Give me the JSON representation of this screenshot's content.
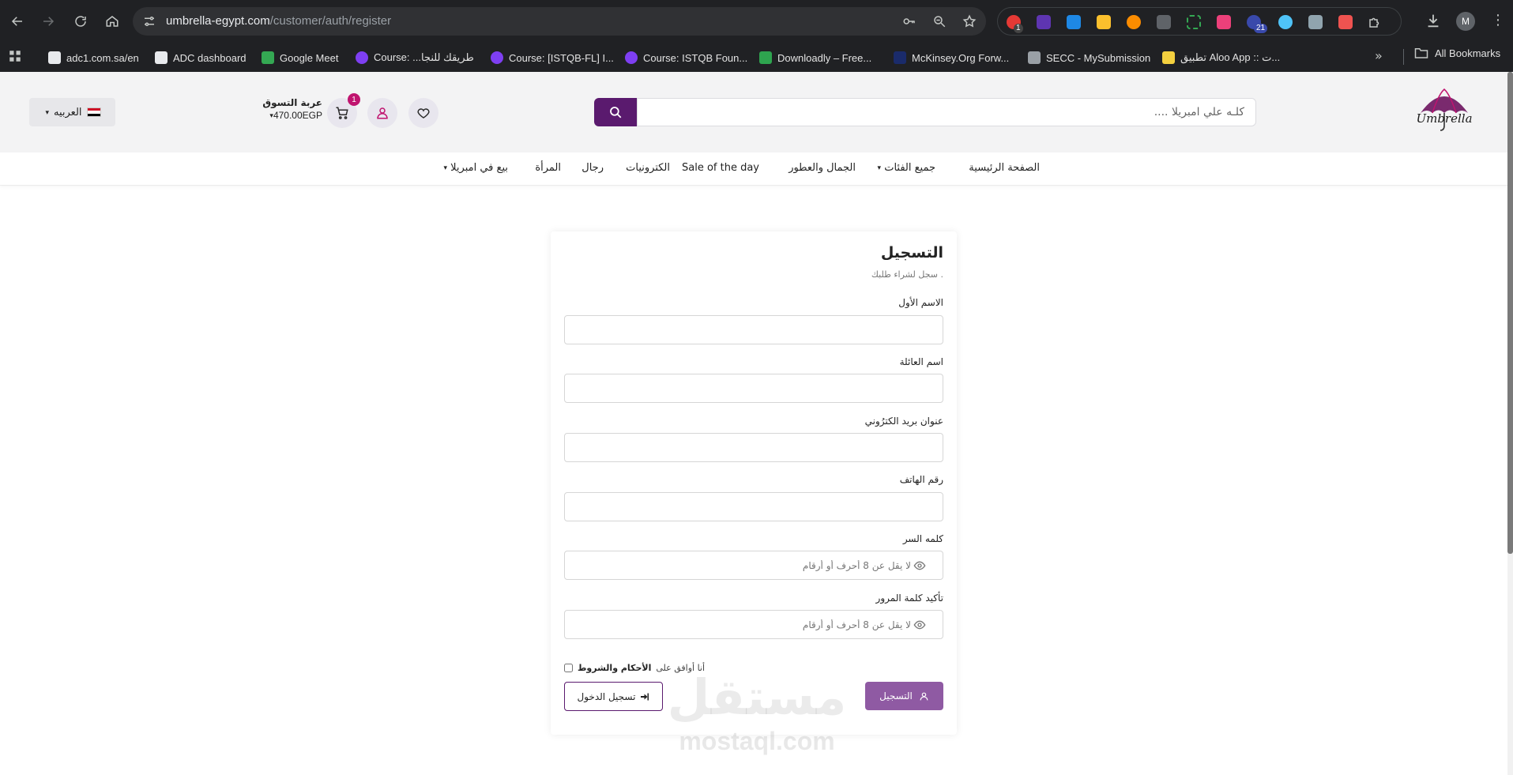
{
  "browser": {
    "url_host": "umbrella-egypt.com",
    "url_path": "/customer/auth/register",
    "extension_badges": [
      "1",
      "21"
    ],
    "profile_initial": "M",
    "bookmarks": [
      {
        "label": "adc1.com.sa/en",
        "color": "#e8eaed"
      },
      {
        "label": "ADC dashboard",
        "color": "#e8eaed"
      },
      {
        "label": "Google Meet",
        "color": "#34a853"
      },
      {
        "label": "Course: ...طريقك للنجا",
        "color": "#7e3ff2"
      },
      {
        "label": "Course: [ISTQB-FL] I...",
        "color": "#7e3ff2"
      },
      {
        "label": "Course: ISTQB Foun...",
        "color": "#7e3ff2"
      },
      {
        "label": "Downloadly – Free...",
        "color": "#2ea44f"
      },
      {
        "label": "McKinsey.Org Forw...",
        "color": "#1a2b6b"
      },
      {
        "label": "SECC - MySubmission",
        "color": "#9aa0a6"
      },
      {
        "label": "تطبيق Aloo App :: ت...",
        "color": "#f4d03f"
      }
    ],
    "all_bookmarks": "All Bookmarks"
  },
  "header": {
    "search_placeholder": "كلـه علي امبريلا ....",
    "cart_badge": "1",
    "cart_title": "عربة التسوق",
    "cart_total": "470.00EGP",
    "language": "العربيه"
  },
  "nav": [
    {
      "label": "الصفحة الرئيسية"
    },
    {
      "label": "جميع الفئات"
    },
    {
      "label": "الجمال والعطور"
    },
    {
      "label": "Sale of the day"
    },
    {
      "label": "الكترونيات"
    },
    {
      "label": "رجال"
    },
    {
      "label": "المرأة"
    },
    {
      "label": "بيع في امبريلا"
    }
  ],
  "form": {
    "title": "التسجيل",
    "subtitle": ". سجل لشراء طلبك",
    "fields": [
      {
        "label": "الاسم الأول",
        "placeholder": ""
      },
      {
        "label": "اسم العائلة",
        "placeholder": ""
      },
      {
        "label": "عنوان بريد الكترُوني",
        "placeholder": ""
      },
      {
        "label": "رقم الهاتف",
        "placeholder": ""
      },
      {
        "label": "كلمه السر",
        "placeholder": "لا يقل عن 8 أحرف أو أرقام"
      },
      {
        "label": "تأكيد كلمة المرور",
        "placeholder": "لا يقل عن 8 أحرف أو أرقام"
      }
    ],
    "terms_prefix": "أنا أوافق على",
    "terms_link": "الأحكام والشروط",
    "register_button": "التسجيل",
    "login_button": "تسجيل الدخول"
  },
  "watermark": {
    "arabic": "مستقل",
    "latin": "mostaql.com"
  }
}
